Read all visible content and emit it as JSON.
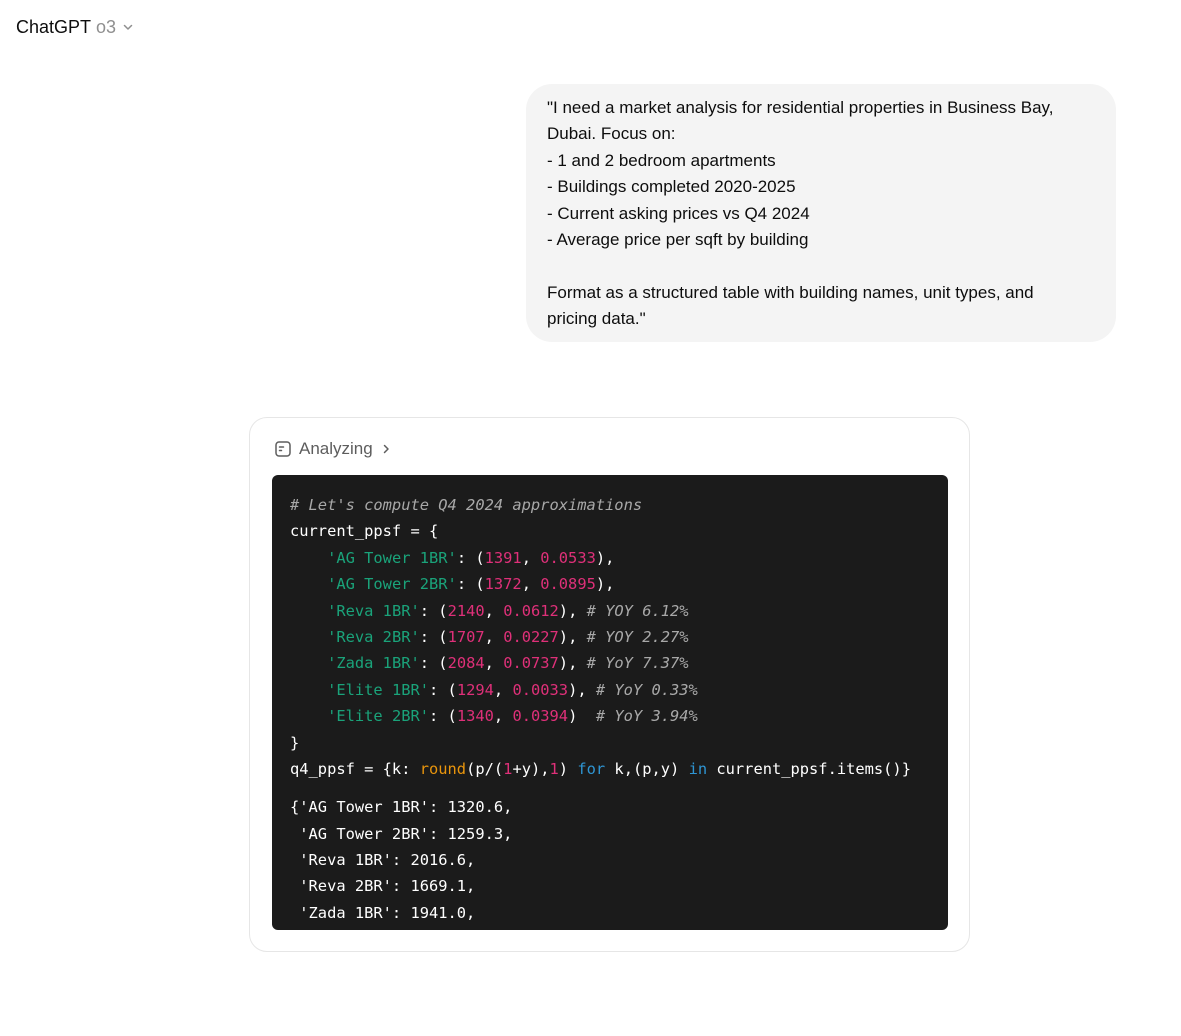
{
  "header": {
    "app_name": "ChatGPT",
    "model_name": "o3",
    "icon": "chevron-down-icon"
  },
  "user_message": {
    "lines": [
      "\"I need a market analysis for residential properties in Business Bay,",
      "Dubai. Focus on:",
      "- 1 and 2 bedroom apartments",
      "- Buildings completed 2020-2025",
      "- Current asking prices vs Q4 2024",
      "- Average price per sqft by building",
      "",
      "Format as a structured table with building names, unit types, and",
      "pricing data.\""
    ]
  },
  "analysis": {
    "status_label": "Analyzing",
    "status_icon": "code-interpreter-icon",
    "expand_icon": "chevron-right-icon",
    "code_lines": [
      [
        {
          "t": "comment",
          "v": "# Let's compute Q4 2024 approximations"
        }
      ],
      [
        {
          "t": "plain",
          "v": "current_ppsf = {"
        }
      ],
      [
        {
          "t": "plain",
          "v": "    "
        },
        {
          "t": "string",
          "v": "'AG Tower 1BR'"
        },
        {
          "t": "plain",
          "v": ": ("
        },
        {
          "t": "number",
          "v": "1391"
        },
        {
          "t": "plain",
          "v": ", "
        },
        {
          "t": "number",
          "v": "0.0533"
        },
        {
          "t": "plain",
          "v": "),"
        }
      ],
      [
        {
          "t": "plain",
          "v": "    "
        },
        {
          "t": "string",
          "v": "'AG Tower 2BR'"
        },
        {
          "t": "plain",
          "v": ": ("
        },
        {
          "t": "number",
          "v": "1372"
        },
        {
          "t": "plain",
          "v": ", "
        },
        {
          "t": "number",
          "v": "0.0895"
        },
        {
          "t": "plain",
          "v": "),"
        }
      ],
      [
        {
          "t": "plain",
          "v": "    "
        },
        {
          "t": "string",
          "v": "'Reva 1BR'"
        },
        {
          "t": "plain",
          "v": ": ("
        },
        {
          "t": "number",
          "v": "2140"
        },
        {
          "t": "plain",
          "v": ", "
        },
        {
          "t": "number",
          "v": "0.0612"
        },
        {
          "t": "plain",
          "v": "), "
        },
        {
          "t": "comment",
          "v": "# YOY 6.12%"
        }
      ],
      [
        {
          "t": "plain",
          "v": "    "
        },
        {
          "t": "string",
          "v": "'Reva 2BR'"
        },
        {
          "t": "plain",
          "v": ": ("
        },
        {
          "t": "number",
          "v": "1707"
        },
        {
          "t": "plain",
          "v": ", "
        },
        {
          "t": "number",
          "v": "0.0227"
        },
        {
          "t": "plain",
          "v": "), "
        },
        {
          "t": "comment",
          "v": "# YOY 2.27%"
        }
      ],
      [
        {
          "t": "plain",
          "v": "    "
        },
        {
          "t": "string",
          "v": "'Zada 1BR'"
        },
        {
          "t": "plain",
          "v": ": ("
        },
        {
          "t": "number",
          "v": "2084"
        },
        {
          "t": "plain",
          "v": ", "
        },
        {
          "t": "number",
          "v": "0.0737"
        },
        {
          "t": "plain",
          "v": "), "
        },
        {
          "t": "comment",
          "v": "# YoY 7.37%"
        }
      ],
      [
        {
          "t": "plain",
          "v": "    "
        },
        {
          "t": "string",
          "v": "'Elite 1BR'"
        },
        {
          "t": "plain",
          "v": ": ("
        },
        {
          "t": "number",
          "v": "1294"
        },
        {
          "t": "plain",
          "v": ", "
        },
        {
          "t": "number",
          "v": "0.0033"
        },
        {
          "t": "plain",
          "v": "), "
        },
        {
          "t": "comment",
          "v": "# YoY 0.33%"
        }
      ],
      [
        {
          "t": "plain",
          "v": "    "
        },
        {
          "t": "string",
          "v": "'Elite 2BR'"
        },
        {
          "t": "plain",
          "v": ": ("
        },
        {
          "t": "number",
          "v": "1340"
        },
        {
          "t": "plain",
          "v": ", "
        },
        {
          "t": "number",
          "v": "0.0394"
        },
        {
          "t": "plain",
          "v": ")  "
        },
        {
          "t": "comment",
          "v": "# YoY 3.94%"
        }
      ],
      [
        {
          "t": "plain",
          "v": "}"
        }
      ],
      [
        {
          "t": "plain",
          "v": "q4_ppsf = {k: "
        },
        {
          "t": "builtin",
          "v": "round"
        },
        {
          "t": "plain",
          "v": "(p/("
        },
        {
          "t": "number",
          "v": "1"
        },
        {
          "t": "plain",
          "v": "+y),"
        },
        {
          "t": "number",
          "v": "1"
        },
        {
          "t": "plain",
          "v": ") "
        },
        {
          "t": "keyword",
          "v": "for"
        },
        {
          "t": "plain",
          "v": " k,(p,y) "
        },
        {
          "t": "keyword",
          "v": "in"
        },
        {
          "t": "plain",
          "v": " current_ppsf.items()}"
        }
      ]
    ],
    "output_lines": [
      "{'AG Tower 1BR': 1320.6,",
      " 'AG Tower 2BR': 1259.3,",
      " 'Reva 1BR': 2016.6,",
      " 'Reva 2BR': 1669.1,",
      " 'Zada 1BR': 1941.0,"
    ]
  },
  "colors": {
    "code_background": "#1b1b1b",
    "string": "#1aa37a",
    "number": "#df3079",
    "keyword": "#2e95d3",
    "builtin": "#e9950c",
    "comment": "#a8a8a8",
    "bubble_background": "#f4f4f4"
  }
}
